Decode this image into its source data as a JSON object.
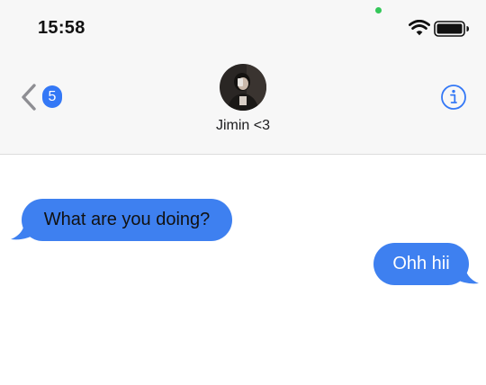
{
  "status_bar": {
    "time": "15:58",
    "icons": [
      "mic-indicator-dot",
      "wifi-icon",
      "battery-icon"
    ]
  },
  "nav": {
    "back_icon": "chevron-left-icon",
    "unread_count": "5",
    "contact_name": "Jimin <3",
    "info_icon": "info-icon"
  },
  "messages": [
    {
      "direction": "incoming",
      "text": "What are you doing?"
    },
    {
      "direction": "outgoing",
      "text": "Ohh hii"
    }
  ],
  "colors": {
    "bubble": "#3e80f0",
    "accent": "#3478f6",
    "mic_dot": "#34c759",
    "header_bg": "#f7f7f7"
  }
}
